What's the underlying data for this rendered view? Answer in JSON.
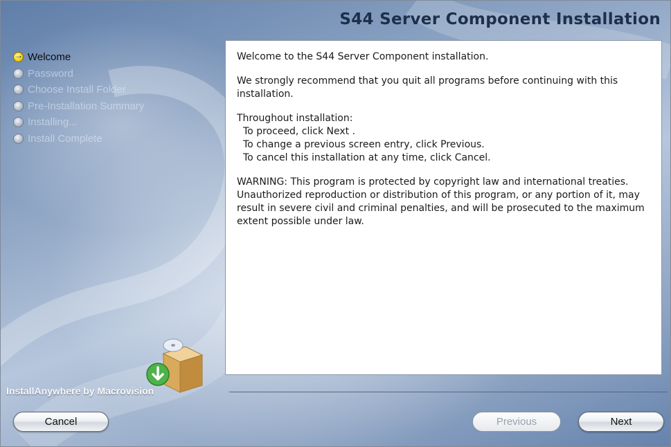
{
  "window": {
    "title": "S44 Server Component Installation"
  },
  "steps": [
    {
      "label": "Welcome",
      "state": "active"
    },
    {
      "label": "Password",
      "state": "inactive"
    },
    {
      "label": "Choose Install Folder",
      "state": "inactive"
    },
    {
      "label": "Pre-Installation Summary",
      "state": "inactive"
    },
    {
      "label": "Installing...",
      "state": "inactive"
    },
    {
      "label": "Install Complete",
      "state": "inactive"
    }
  ],
  "content": {
    "intro": "Welcome to the S44 Server Component installation.",
    "recommend": "We strongly recommend that you quit all programs before continuing with this installation.",
    "throughout": "Throughout installation:",
    "instructions": [
      "To proceed, click Next .",
      "To change a previous screen entry, click Previous.",
      "To cancel this installation at any time, click Cancel."
    ],
    "warning": "WARNING: This program is protected by copyright law and international treaties.  Unauthorized reproduction or distribution of this program, or any portion of it, may result in severe civil and criminal penalties, and will be prosecuted to the maximum extent possible under law."
  },
  "footer": {
    "brand": "InstallAnywhere by Macrovision",
    "cancel_label": "Cancel",
    "previous_label": "Previous",
    "next_label": "Next"
  },
  "colors": {
    "active_bullet": "#f2cf19",
    "title_text": "#1d2f4a"
  },
  "icons": {
    "active_step": "arrow-right-icon",
    "inactive_step": "radio-circle-icon",
    "installer_logo": "install-box-icon"
  }
}
